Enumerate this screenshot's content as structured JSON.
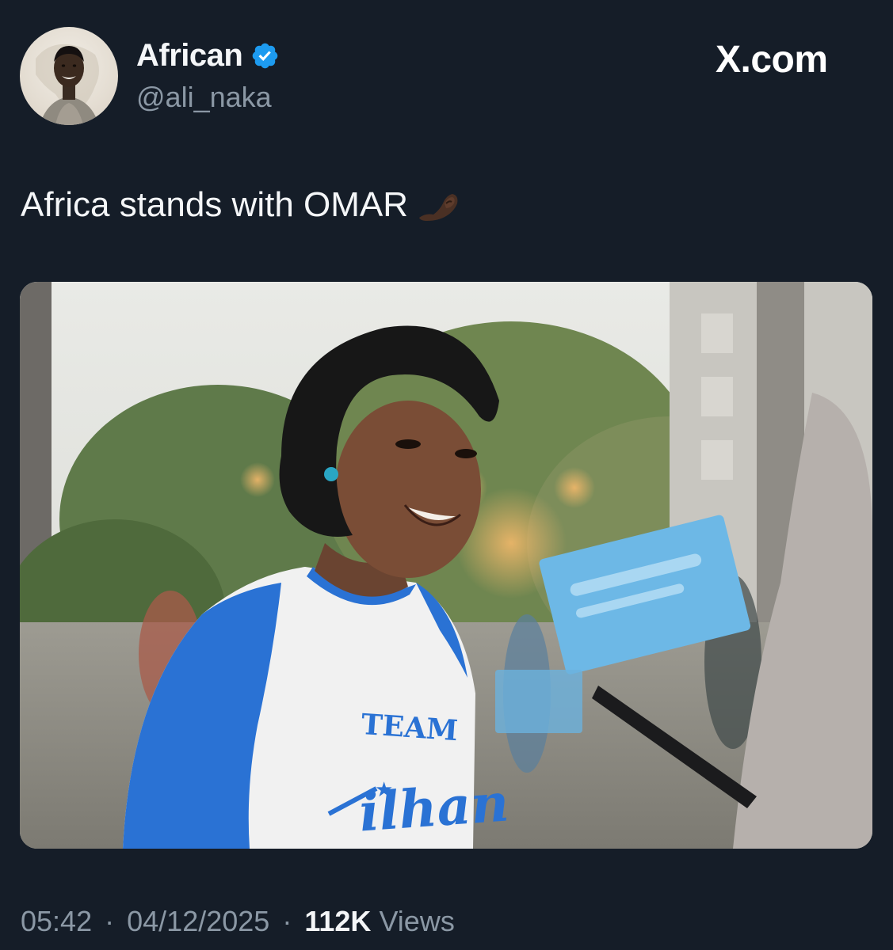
{
  "author": {
    "display_name": "African",
    "handle": "@ali_naka",
    "verified": true,
    "verified_badge_color": "#1d9bf0"
  },
  "brand": {
    "site": "X.com"
  },
  "tweet": {
    "text": "Africa stands with OMAR",
    "emoji_icon": "pinched-fingers-emoji-dark-skin-tone",
    "media": {
      "shirt_text_top": "TEAM",
      "shirt_text_bottom": "ilhan",
      "shirt_sleeve_color": "#2a72d4",
      "sign_color": "#6db8e6"
    }
  },
  "footer": {
    "time": "05:42",
    "date": "04/12/2025",
    "separator": "·",
    "views_count": "112K",
    "views_label": "Views"
  },
  "colors": {
    "background": "#151d28",
    "primary_text": "#f4f6f8",
    "secondary_text": "#8b98a5"
  }
}
